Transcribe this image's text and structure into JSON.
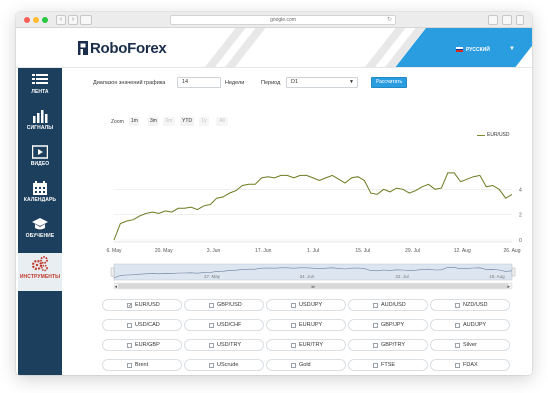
{
  "browser": {
    "url": "google.com",
    "back_glyph": "‹",
    "forward_glyph": "›",
    "reload_glyph": "↻"
  },
  "header": {
    "logo_text": "RoboForex",
    "language": "РУССКИЙ",
    "language_caret": "▼",
    "accent_color": "#2a9de1"
  },
  "sidebar": {
    "bg_color": "#1d3f5e",
    "items": [
      {
        "label": "ЛЕНТА",
        "icon": "list-icon"
      },
      {
        "label": "СИГНАЛЫ",
        "icon": "bar-chart-icon"
      },
      {
        "label": "ВИДЕО",
        "icon": "play-icon"
      },
      {
        "label": "КАЛЕНДАРЬ",
        "icon": "calendar-icon"
      },
      {
        "label": "ОБУЧЕНИЕ",
        "icon": "graduation-cap-icon"
      },
      {
        "label": "ИНСТРУМЕНТЫ",
        "icon": "gears-icon",
        "active": true
      }
    ]
  },
  "controls": {
    "range_label": "Диапазон значений графика",
    "range_value": "14",
    "range_unit": "Недели",
    "period_label": "Период",
    "period_value": "D1",
    "period_caret": "▼",
    "calc_button": "Рассчитать"
  },
  "zoom": {
    "label": "Zoom",
    "options": [
      {
        "label": "1m",
        "enabled": true
      },
      {
        "label": "3m",
        "enabled": true
      },
      {
        "label": "6m",
        "enabled": false
      },
      {
        "label": "YTD",
        "enabled": true
      },
      {
        "label": "1y",
        "enabled": false
      },
      {
        "label": "All",
        "enabled": false
      }
    ]
  },
  "chart_data": {
    "type": "line",
    "series": [
      {
        "name": "EUR/USD",
        "color": "#6b7a1f",
        "values": [
          0.0,
          1.3,
          1.5,
          1.6,
          1.9,
          2.1,
          2.2,
          2.1,
          2.3,
          2.2,
          2.5,
          2.5,
          2.6,
          2.4,
          2.7,
          2.8,
          3.3,
          3.4,
          3.7,
          3.9,
          4.3,
          4.4,
          4.4,
          4.9,
          5.0,
          4.9,
          5.1,
          5.1,
          4.9,
          5.1,
          5.1,
          4.9,
          4.7,
          4.9,
          5.1,
          4.8,
          4.5,
          4.9,
          5.0,
          4.7,
          3.7,
          3.6,
          4.0,
          3.8,
          4.1,
          4.0,
          3.7,
          3.9,
          4.2,
          4.4,
          4.0,
          4.1,
          5.3,
          5.3,
          4.6,
          4.8,
          5.0,
          5.1,
          4.2,
          4.3,
          4.0,
          3.3,
          3.6
        ]
      }
    ],
    "x_tick_labels": [
      "6. May",
      "20. May",
      "3. Jun",
      "17. Jun",
      "1. Jul",
      "15. Jul",
      "29. Jul",
      "12. Aug",
      "26. Aug"
    ],
    "y_tick_labels": [
      "0",
      "2",
      "4"
    ],
    "ylim": [
      0,
      6
    ],
    "grid": true,
    "legend_position": "top-right",
    "navigator_tick_labels": [
      "27. May",
      "24. Jun",
      "22. Jul",
      "19. Aug"
    ],
    "navigator_handle_glyph": "≡",
    "navigator_arrows": [
      "◂",
      "▸"
    ]
  },
  "instruments": {
    "checked_glyph": "✓",
    "items": [
      {
        "label": "EUR/USD",
        "checked": true
      },
      {
        "label": "GBP/USD",
        "checked": false
      },
      {
        "label": "USD/JPY",
        "checked": false
      },
      {
        "label": "AUD/USD",
        "checked": false
      },
      {
        "label": "NZD/USD",
        "checked": false
      },
      {
        "label": "USD/CAD",
        "checked": false
      },
      {
        "label": "USD/CHF",
        "checked": false
      },
      {
        "label": "EUR/JPY",
        "checked": false
      },
      {
        "label": "GBP/JPY",
        "checked": false
      },
      {
        "label": "AUD/JPY",
        "checked": false
      },
      {
        "label": "EUR/GBP",
        "checked": false
      },
      {
        "label": "USD/TRY",
        "checked": false
      },
      {
        "label": "EUR/TRY",
        "checked": false
      },
      {
        "label": "GBP/TRY",
        "checked": false
      },
      {
        "label": "Silver",
        "checked": false
      },
      {
        "label": "Brent",
        "checked": false
      },
      {
        "label": "UScrude",
        "checked": false
      },
      {
        "label": "Gold",
        "checked": false
      },
      {
        "label": "FTSE",
        "checked": false
      },
      {
        "label": "FDAX",
        "checked": false
      }
    ]
  }
}
